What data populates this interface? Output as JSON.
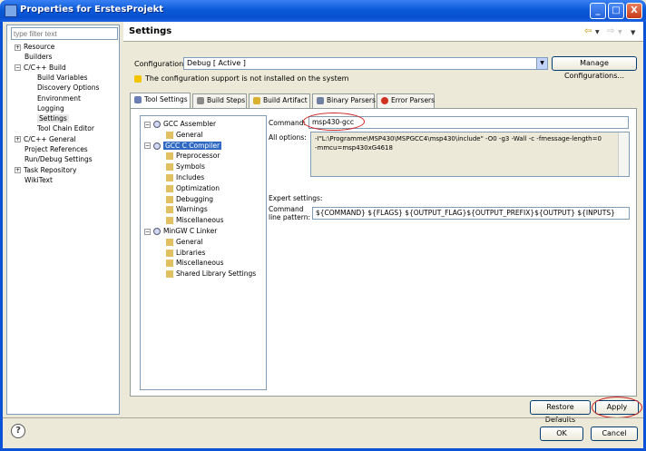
{
  "window": {
    "title": "Properties for ErstesProjekt",
    "minimize": "_",
    "maximize": "□",
    "close": "X"
  },
  "left": {
    "filter_placeholder": "type filter text",
    "items": [
      {
        "label": "Resource",
        "expander": "+",
        "level": 0
      },
      {
        "label": "Builders",
        "level": 0
      },
      {
        "label": "C/C++ Build",
        "expander": "−",
        "level": 0
      },
      {
        "label": "Build Variables",
        "level": 1
      },
      {
        "label": "Discovery Options",
        "level": 1
      },
      {
        "label": "Environment",
        "level": 1
      },
      {
        "label": "Logging",
        "level": 1
      },
      {
        "label": "Settings",
        "level": 1,
        "selected": true
      },
      {
        "label": "Tool Chain Editor",
        "level": 1
      },
      {
        "label": "C/C++ General",
        "expander": "+",
        "level": 0
      },
      {
        "label": "Project References",
        "level": 0
      },
      {
        "label": "Run/Debug Settings",
        "level": 0
      },
      {
        "label": "Task Repository",
        "expander": "+",
        "level": 0
      },
      {
        "label": "WikiText",
        "level": 0
      }
    ]
  },
  "header": {
    "title": "Settings"
  },
  "config": {
    "label": "Configuration:",
    "value": "Debug  [ Active ]",
    "manage_button": "Manage Configurations...",
    "warning": "The configuration support is not installed on the system"
  },
  "tabs": [
    {
      "label": "Tool Settings",
      "active": true,
      "icon": "gear-icon",
      "color": "#6a7fb5"
    },
    {
      "label": "Build Steps",
      "icon": "wrench-icon",
      "color": "#8a8a8a"
    },
    {
      "label": "Build Artifact",
      "icon": "artifact-icon",
      "color": "#d9b030"
    },
    {
      "label": "Binary Parsers",
      "icon": "binary-icon",
      "color": "#7080a0"
    },
    {
      "label": "Error Parsers",
      "icon": "error-icon",
      "color": "#d03020"
    }
  ],
  "tool_tree": [
    {
      "label": "GCC Assembler",
      "expander": "−",
      "level": 0
    },
    {
      "label": "General",
      "level": 1
    },
    {
      "label": "GCC C Compiler",
      "expander": "−",
      "level": 0,
      "selected": true
    },
    {
      "label": "Preprocessor",
      "level": 1
    },
    {
      "label": "Symbols",
      "level": 1
    },
    {
      "label": "Includes",
      "level": 1
    },
    {
      "label": "Optimization",
      "level": 1
    },
    {
      "label": "Debugging",
      "level": 1
    },
    {
      "label": "Warnings",
      "level": 1
    },
    {
      "label": "Miscellaneous",
      "level": 1
    },
    {
      "label": "MinGW C Linker",
      "expander": "−",
      "level": 0
    },
    {
      "label": "General",
      "level": 1
    },
    {
      "label": "Libraries",
      "level": 1
    },
    {
      "label": "Miscellaneous",
      "level": 1
    },
    {
      "label": "Shared Library Settings",
      "level": 1
    }
  ],
  "command": {
    "label": "Command:",
    "value": "msp430-gcc"
  },
  "all_options": {
    "label": "All options:",
    "line1": "-I\"L:\\Programme\\MSP430\\MSPGCC4\\msp430\\include\" -O0 -g3 -Wall -c -fmessage-length=0",
    "line2": "-mmcu=msp430xG4618"
  },
  "expert": {
    "label": "Expert settings:",
    "pattern_label_1": "Command",
    "pattern_label_2": "line pattern:",
    "pattern": "${COMMAND} ${FLAGS} ${OUTPUT_FLAG}${OUTPUT_PREFIX}${OUTPUT} ${INPUTS}"
  },
  "buttons": {
    "restore": "Restore Defaults",
    "apply": "Apply",
    "ok": "OK",
    "cancel": "Cancel"
  },
  "help": "?"
}
